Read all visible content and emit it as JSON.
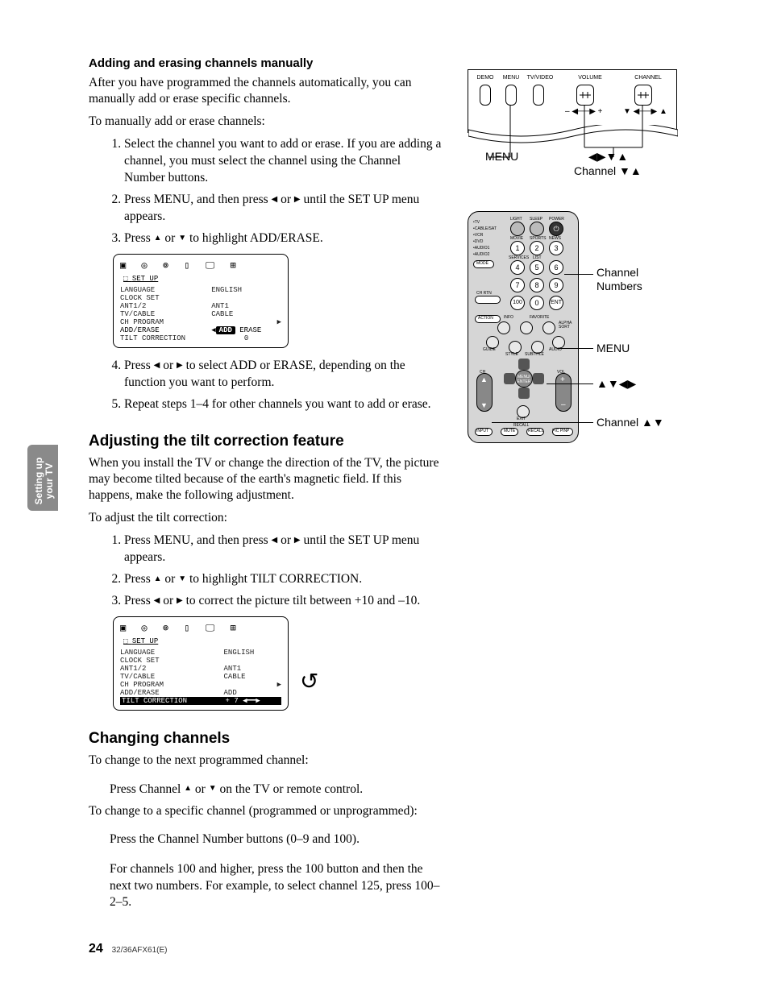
{
  "sideTab": {
    "line1": "Setting up",
    "line2": "your TV"
  },
  "h_add": "Adding and erasing channels manually",
  "p1": "After you have programmed the channels automatically, you can manually add or erase specific channels.",
  "p2": "To manually add or erase channels:",
  "s1_1": "Select the channel you want to add or erase. If you are adding a channel, you must select the channel using the Channel Number buttons.",
  "s1_2a": "Press MENU, and then press ",
  "s1_2b": " or ",
  "s1_2c": " until the SET UP menu appears.",
  "s1_3a": "Press ",
  "s1_3b": " or ",
  "s1_3c": " to highlight ADD/ERASE.",
  "s1_4a": "Press ",
  "s1_4b": " or ",
  "s1_4c": " to select ADD or ERASE, depending on the function you want to perform.",
  "s1_5": "Repeat steps 1–4 for other channels you want to add or erase.",
  "h_tilt": "Adjusting the tilt correction feature",
  "p3": "When you install the TV or change the direction of the TV, the picture may become tilted because of the earth's magnetic field. If this happens, make the following adjustment.",
  "p4": "To adjust the tilt correction:",
  "s2_1a": "Press MENU, and then press ",
  "s2_1b": " or ",
  "s2_1c": " until the SET UP menu appears.",
  "s2_2a": "Press ",
  "s2_2b": " or ",
  "s2_2c": " to highlight TILT CORRECTION.",
  "s2_3a": "Press ",
  "s2_3b": " or ",
  "s2_3c": " to correct the picture tilt between +10 and –10.",
  "h_chg": "Changing channels",
  "p5": "To change to the next programmed channel:",
  "p5a_a": "Press Channel ",
  "p5a_b": " or ",
  "p5a_c": " on the TV or remote control.",
  "p6": "To change to a specific channel (programmed or unprogrammed):",
  "p6a": "Press the Channel Number buttons (0–9 and 100).",
  "p6b": "For channels 100 and higher, press the 100 button and then the next two numbers. For example, to select channel 125, press 100–2–5.",
  "osd": {
    "title": "SET UP",
    "rows": [
      [
        "LANGUAGE",
        "ENGLISH"
      ],
      [
        "CLOCK SET",
        ""
      ],
      [
        "ANT1/2",
        "ANT1"
      ],
      [
        "TV/CABLE",
        "CABLE"
      ],
      [
        "CH PROGRAM",
        "▶"
      ]
    ],
    "addRow": [
      "ADD/ERASE",
      "ADD",
      "ERASE"
    ],
    "addRowB": [
      "ADD/ERASE",
      "ADD"
    ],
    "tiltRow": [
      "TILT CORRECTION",
      "0"
    ],
    "tiltRowHL": [
      "TILT CORRECTION",
      "+  7"
    ]
  },
  "tv": {
    "labels": {
      "demo": "DEMO",
      "menu": "MENU",
      "tvvideo": "TV/VIDEO",
      "volume": "VOLUME",
      "channel": "CHANNEL"
    },
    "caption_menu": "MENU",
    "caption_arrows": "◀▶▼▲",
    "caption_channel": "Channel ▼▲"
  },
  "remote": {
    "devices": [
      "•TV",
      "•CABLE/SAT",
      "•VCR",
      "•DVD",
      "•AUDIO1",
      "•AUDIO2"
    ],
    "topRow": [
      "LIGHT",
      "SLEEP",
      "POWER"
    ],
    "row_a": [
      "MOVIE",
      "SPORTS",
      "NEWS"
    ],
    "row_b": [
      "SERVICES",
      "LIST",
      ""
    ],
    "mode": "MODE",
    "nums": [
      "1",
      "2",
      "3",
      "4",
      "5",
      "6",
      "7",
      "8",
      "9",
      "100",
      "0",
      "ENT"
    ],
    "mid": [
      "CH RTN",
      "ACTION",
      "INFO",
      "FAVORITE"
    ],
    "around": [
      "GUIDE",
      "STYLE",
      "SUBTITLE",
      "AUDIO",
      "ALPHA SORT"
    ],
    "center": "MENU/\nENTER",
    "ch": "CH",
    "vol": "VOL",
    "exit": "EXIT",
    "recall": "RECALL",
    "bottom": [
      "INPUT",
      "MUTE",
      "RECALL",
      "PIC PINP"
    ],
    "callout_num": "Channel\nNumbers",
    "callout_menu": "MENU",
    "callout_arrows": "▲▼◀▶",
    "callout_ch": "Channel ▲▼"
  },
  "footer": {
    "page": "24",
    "model": "32/36AFX61(E)"
  }
}
